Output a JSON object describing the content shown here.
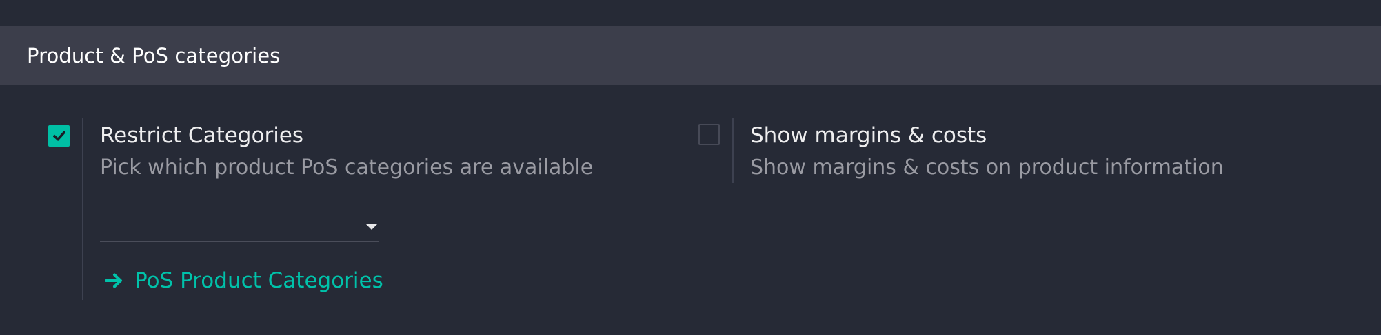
{
  "section": {
    "title": "Product & PoS categories"
  },
  "settings": [
    {
      "title": "Restrict Categories",
      "description": "Pick which product PoS categories are available",
      "checked": true,
      "dropdown_value": "",
      "link_label": "PoS Product Categories",
      "link_icon": "arrow-right-icon"
    },
    {
      "title": "Show margins & costs",
      "description": "Show margins & costs on product information",
      "checked": false
    }
  ],
  "colors": {
    "background": "#262a36",
    "section_header": "#3c3e4b",
    "accent": "#00bfa5",
    "muted_text": "#9a9ba3"
  }
}
